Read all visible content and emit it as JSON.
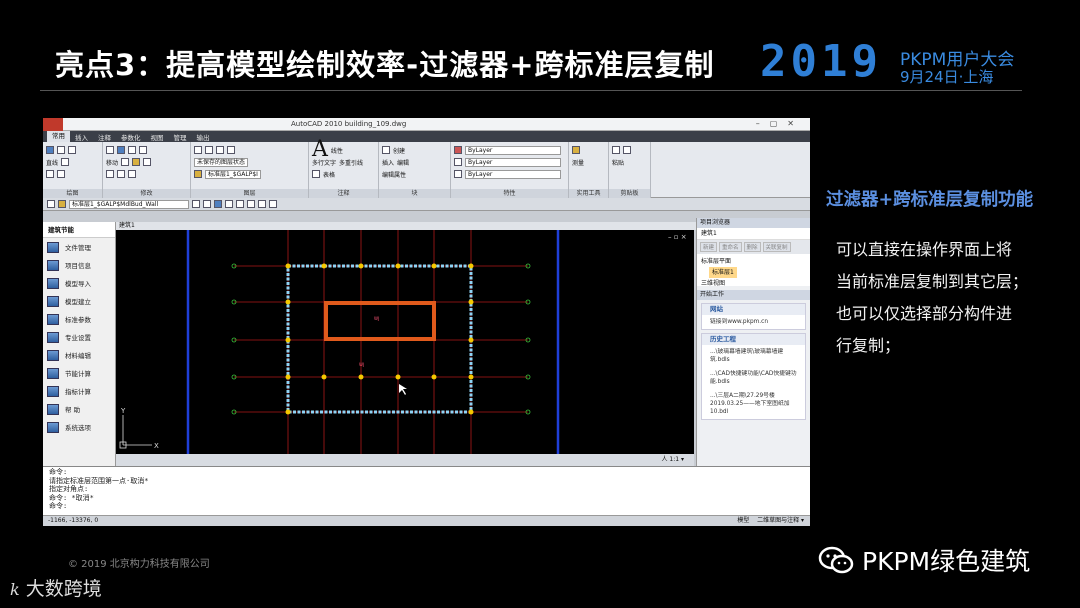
{
  "header": {
    "title": "亮点3：提高模型绘制效率-过滤器+跨标准层复制",
    "logo_year": "2019",
    "logo_line1": "PKPM用户大会",
    "logo_line2": "9月24日·上海"
  },
  "window": {
    "title": "AutoCAD 2010    building_109.dwg",
    "tabs": [
      "常用",
      "插入",
      "注释",
      "参数化",
      "视图",
      "管理",
      "输出"
    ],
    "groups": {
      "draw": "绘图",
      "modify": "修改",
      "layer": "图层",
      "annotation": "注释",
      "block": "块",
      "properties": "特性",
      "utilities": "实用工具",
      "clipboard": "剪贴板"
    },
    "ribbon_labels": {
      "line": "直线",
      "move": "移动",
      "layer_state": "未保存的图层状态",
      "layer_current": "标准层1_$GALP$I",
      "multiline_text": "多行文字",
      "linear": "线性",
      "multileader": "多重引线",
      "table": "表格",
      "insert": "插入",
      "create": "创建",
      "edit": "编辑",
      "edit_attr": "编辑属性",
      "bylayer": "ByLayer",
      "measure": "测量",
      "paste": "粘贴"
    },
    "toolbar2_layer": "标准层1_$GALP$MdlBud_Wall",
    "left_panel": {
      "header": "建筑节能",
      "items": [
        "文件管理",
        "项目信息",
        "模型导入",
        "模型建立",
        "标准参数",
        "专业设置",
        "材料编辑",
        "节能计算",
        "指标计算",
        "帮  助",
        "系统选项"
      ]
    },
    "canvas": {
      "tab": "建筑1",
      "axis_y": "Y",
      "axis_x": "X",
      "dim_label_1": "WJ",
      "dim_label_2": "WJ",
      "nav_label": "人 1:1 ▾"
    },
    "right_panel": {
      "title": "项目浏览器",
      "current": "建筑1",
      "buttons": [
        "新建",
        "重命名",
        "删除",
        "关联复制"
      ],
      "tree_parent": "标准层平面",
      "tree_selected": "标准层1",
      "tree_3d": "三维视图",
      "start_title": "开始工作",
      "website_title": "网站",
      "website_body": "链接到www.pkpm.cn",
      "history_title": "历史工程",
      "history_items": [
        "...\\玻璃幕墙建筑\\玻璃幕墙建筑.bdls",
        "...\\CAD快捷键功能\\CAD快捷键功能.bdls",
        "...\\三层A二期\\27.29号楼2019.03.25——地下室图纸加10.bdl"
      ]
    },
    "command_lines": [
      "命令:",
      "请指定标准层范围第一点·取消*",
      "指定对角点:",
      "命令: *取消*",
      "命令:"
    ],
    "status_coords": "-1166, -13376, 0",
    "status_model": "模型",
    "status_right": "二维草图与注释 ▾"
  },
  "side": {
    "title": "过滤器+跨标准层复制功能",
    "lines": [
      "可以直接在操作界面上将",
      "当前标准层复制到其它层；",
      "也可以仅选择部分构件进",
      "行复制；"
    ]
  },
  "footer": {
    "copyright": "© 2019 北京构力科技有限公司",
    "watermark": "大数跨境",
    "brand": "PKPM绿色建筑"
  },
  "colors": {
    "title_blue": "#5b8fe0",
    "logo_blue": "#2f7fd6",
    "beam_orange": "#e05a1c",
    "slab_outline": "#8fd3f5",
    "column_yellow": "#f5c800",
    "grid_red": "#b01818",
    "axis_blue": "#1f3fd8"
  }
}
